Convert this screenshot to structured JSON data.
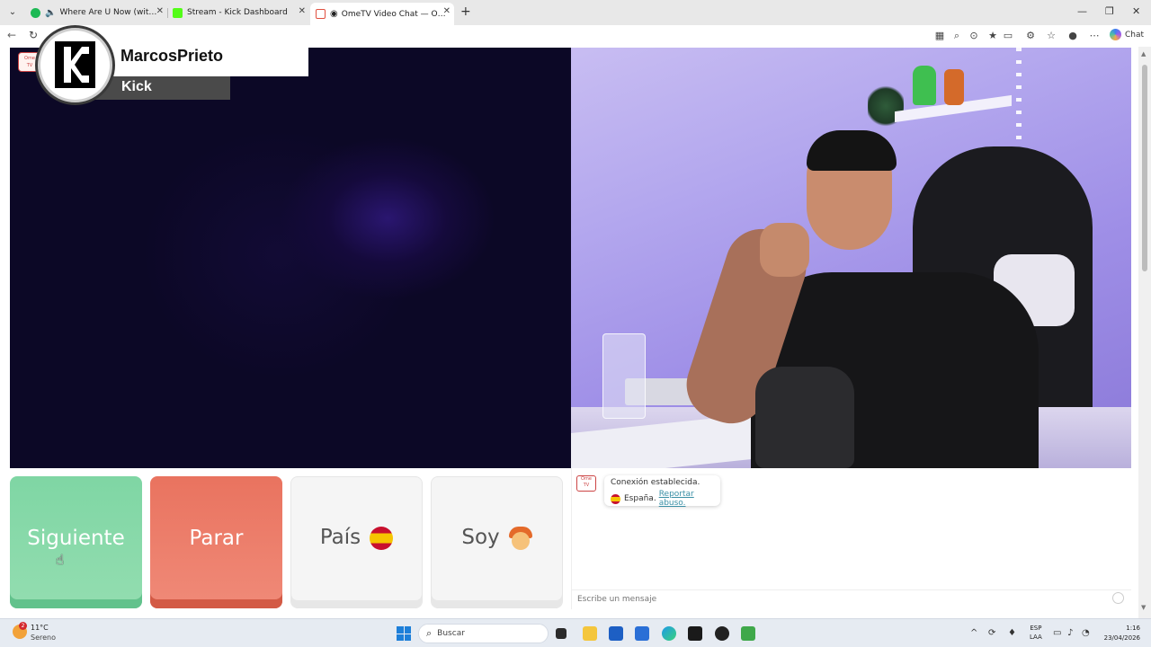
{
  "browser": {
    "tabs": [
      {
        "title": "Where Are Ü Now (with Justin",
        "favicon": "spotify-icon",
        "color": "#1db954",
        "active": false
      },
      {
        "title": "Stream - Kick Dashboard",
        "favicon": "kick-icon",
        "color": "#53fc18",
        "active": false
      },
      {
        "title": "OmeTV Video Chat — Omegle",
        "favicon": "ometv-icon",
        "color": "#e05040",
        "active": true
      }
    ],
    "chat_button_label": "Chat"
  },
  "overlay": {
    "streamer_name": "MarcosPrieto",
    "platform": "Kick"
  },
  "controls": {
    "next_label": "Siguiente",
    "stop_label": "Parar",
    "country_label": "País",
    "country_flag": "spain-flag-icon",
    "gender_label": "Soy",
    "gender_icon": "boy-face-icon"
  },
  "chat": {
    "status_message": "Conexión establecida.",
    "country": "España.",
    "report_link": "Reportar abuso.",
    "input_placeholder": "Escribe un mensaje"
  },
  "taskbar": {
    "temperature": "11°C",
    "weather_condition": "Sereno",
    "weather_alert_count": "2",
    "search_placeholder": "Buscar",
    "language_line1": "ESP",
    "language_line2": "LAA",
    "time": "1:16",
    "date": "23/04/2026"
  },
  "colors": {
    "next_button": "#7fd6a4",
    "stop_button": "#e9735f",
    "neutral_button": "#f5f5f5",
    "link": "#3a8fa5"
  }
}
